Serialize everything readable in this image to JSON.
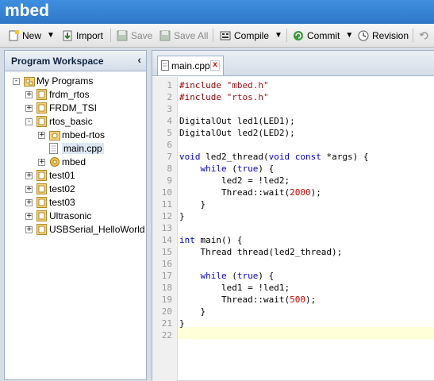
{
  "app": {
    "title": "mbed"
  },
  "toolbar": {
    "new": "New",
    "import": "Import",
    "save": "Save",
    "save_all": "Save All",
    "compile": "Compile",
    "commit": "Commit",
    "revision": "Revision"
  },
  "workspace": {
    "title": "Program Workspace",
    "tree": [
      {
        "label": "My Programs",
        "level": 0,
        "expander": "-"
      },
      {
        "label": "frdm_rtos",
        "level": 1,
        "expander": "+"
      },
      {
        "label": "FRDM_TSI",
        "level": 1,
        "expander": "+"
      },
      {
        "label": "rtos_basic",
        "level": 1,
        "expander": "-"
      },
      {
        "label": "mbed-rtos",
        "level": 2,
        "expander": "+"
      },
      {
        "label": "main.cpp",
        "level": 2,
        "expander": ""
      },
      {
        "label": "mbed",
        "level": 2,
        "expander": "+"
      },
      {
        "label": "test01",
        "level": 1,
        "expander": "+"
      },
      {
        "label": "test02",
        "level": 1,
        "expander": "+"
      },
      {
        "label": "test03",
        "level": 1,
        "expander": "+"
      },
      {
        "label": "Ultrasonic",
        "level": 1,
        "expander": "+"
      },
      {
        "label": "USBSerial_HelloWorld",
        "level": 1,
        "expander": "+"
      }
    ]
  },
  "editor": {
    "tab_label": "main.cpp",
    "tab_close": "x",
    "line_numbers": [
      "1",
      "2",
      "3",
      "4",
      "5",
      "6",
      "7",
      "8",
      "9",
      "10",
      "11",
      "12",
      "13",
      "14",
      "15",
      "16",
      "17",
      "18",
      "19",
      "20",
      "21",
      "22"
    ],
    "lines": [
      "#include \"mbed.h\"",
      "#include \"rtos.h\"",
      "",
      "DigitalOut led1(LED1);",
      "DigitalOut led2(LED2);",
      "",
      "void led2_thread(void const *args) {",
      "    while (true) {",
      "        led2 = !led2;",
      "        Thread::wait(2000);",
      "    }",
      "}",
      "",
      "int main() {",
      "    Thread thread(led2_thread);",
      "",
      "    while (true) {",
      "        led1 = !led1;",
      "        Thread::wait(500);",
      "    }",
      "}",
      ""
    ],
    "current_line": "22"
  },
  "colors": {
    "keyword": "#0000cc",
    "preprocessor": "#990000",
    "string": "#a31515",
    "number": "#cc0000",
    "title_bar": "#3580d2"
  }
}
